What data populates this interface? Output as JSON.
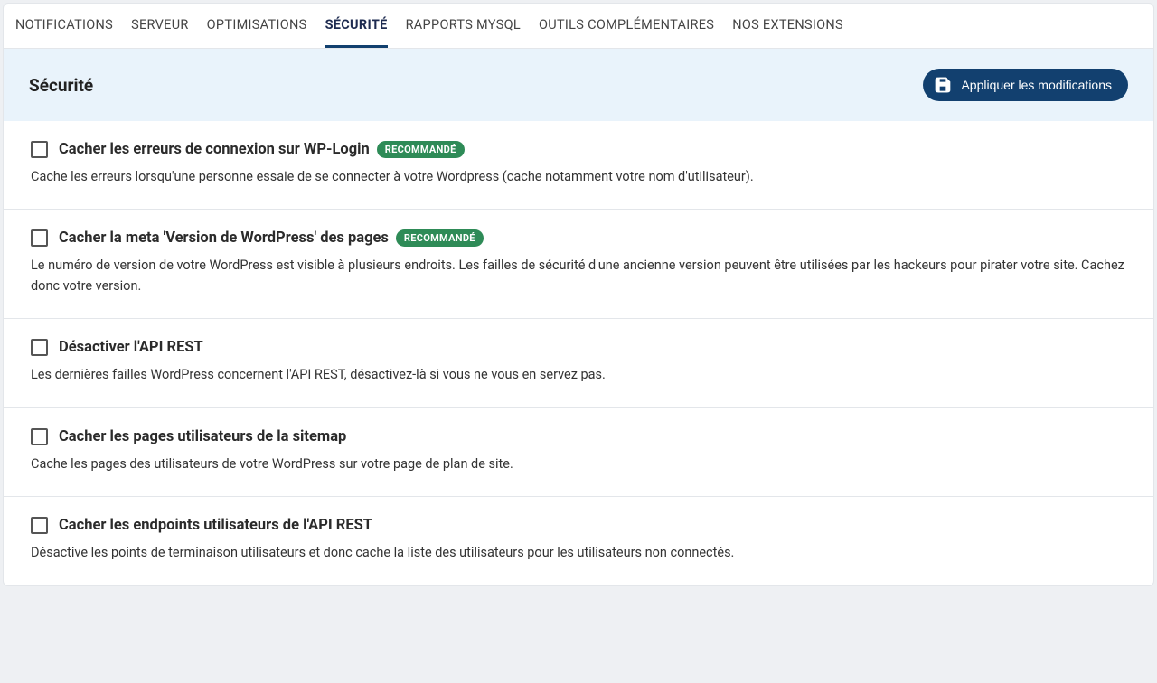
{
  "tabs": [
    {
      "label": "NOTIFICATIONS",
      "active": false
    },
    {
      "label": "SERVEUR",
      "active": false
    },
    {
      "label": "OPTIMISATIONS",
      "active": false
    },
    {
      "label": "SÉCURITÉ",
      "active": true
    },
    {
      "label": "RAPPORTS MYSQL",
      "active": false
    },
    {
      "label": "OUTILS COMPLÉMENTAIRES",
      "active": false
    },
    {
      "label": "NOS EXTENSIONS",
      "active": false
    }
  ],
  "header": {
    "title": "Sécurité",
    "apply_label": "Appliquer les modifications"
  },
  "badge_text": "RECOMMANDÉ",
  "options": [
    {
      "name": "hide-wp-login-errors",
      "title": "Cacher les erreurs de connexion sur WP-Login",
      "recommended": true,
      "desc": "Cache les erreurs lorsqu'une personne essaie de se connecter à votre Wordpress (cache notamment votre nom d'utilisateur)."
    },
    {
      "name": "hide-wp-version-meta",
      "title": "Cacher la meta 'Version de WordPress' des pages",
      "recommended": true,
      "desc": "Le numéro de version de votre WordPress est visible à plusieurs endroits. Les failles de sécurité d'une ancienne version peuvent être utilisées par les hackeurs pour pirater votre site. Cachez donc votre version."
    },
    {
      "name": "disable-rest-api",
      "title": "Désactiver l'API REST",
      "recommended": false,
      "desc": "Les dernières failles WordPress concernent l'API REST, désactivez-là si vous ne vous en servez pas."
    },
    {
      "name": "hide-sitemap-user-pages",
      "title": "Cacher les pages utilisateurs de la sitemap",
      "recommended": false,
      "desc": "Cache les pages des utilisateurs de votre WordPress sur votre page de plan de site."
    },
    {
      "name": "hide-rest-user-endpoints",
      "title": "Cacher les endpoints utilisateurs de l'API REST",
      "recommended": false,
      "desc": "Désactive les points de terminaison utilisateurs et donc cache la liste des utilisateurs pour les utilisateurs non connectés."
    }
  ]
}
